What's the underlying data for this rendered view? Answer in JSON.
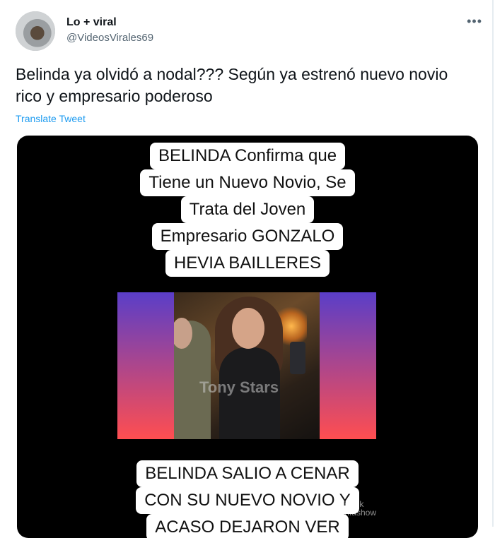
{
  "author": {
    "display_name": "Lo + viral",
    "handle": "@VideosVirales69"
  },
  "more_icon": "more-horizontal-icon",
  "tweet": {
    "text": "Belinda ya olvidó a nodal??? Según ya estrenó nuevo novio rico y empresario poderoso",
    "translate_label": "Translate Tweet"
  },
  "media": {
    "caption_top": [
      "BELINDA Confirma que",
      "Tiene un Nuevo Novio, Se",
      "Trata del Joven",
      "Empresario GONZALO",
      "HEVIA BAILLERES"
    ],
    "video_watermark": "Tony Stars",
    "caption_bottom": [
      "BELINDA SALIO A CENAR",
      "CON SU NUEVO NOVIO Y",
      "ACASO DEJARON VER"
    ],
    "tiktok_label": "TikTok",
    "tiktok_user": "@sonfashow"
  },
  "colors": {
    "link": "#1d9bf0",
    "text": "#0f1419",
    "muted": "#536471"
  }
}
